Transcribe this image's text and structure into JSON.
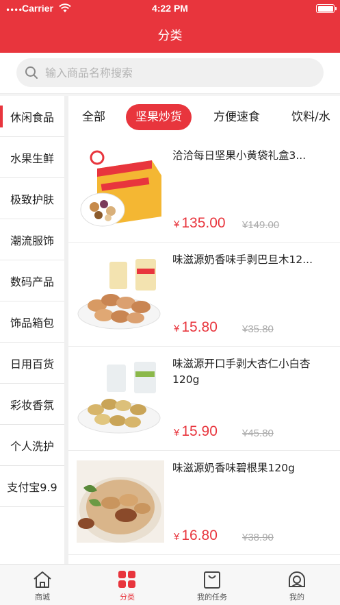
{
  "status": {
    "carrier": "Carrier",
    "time": "4:22 PM"
  },
  "header": {
    "title": "分类"
  },
  "search": {
    "placeholder": "输入商品名称搜索"
  },
  "sidebar": {
    "items": [
      {
        "label": "休闲食品",
        "active": true
      },
      {
        "label": "水果生鲜"
      },
      {
        "label": "极致护肤"
      },
      {
        "label": "潮流服饰"
      },
      {
        "label": "数码产品"
      },
      {
        "label": "饰品箱包"
      },
      {
        "label": "日用百货"
      },
      {
        "label": "彩妆香氛"
      },
      {
        "label": "个人洗护"
      },
      {
        "label": "支付宝9.9"
      }
    ]
  },
  "tabs": [
    {
      "label": "全部"
    },
    {
      "label": "坚果炒货",
      "active": true
    },
    {
      "label": "方便速食"
    },
    {
      "label": "饮料/水"
    }
  ],
  "products": [
    {
      "name": "洽洽每日坚果小黄袋礼盒3...",
      "price": "135.00",
      "old_price": "¥149.00",
      "currency": "¥"
    },
    {
      "name": "味滋源奶香味手剥巴旦木12...",
      "price": "15.80",
      "old_price": "¥35.80",
      "currency": "¥"
    },
    {
      "name": "味滋源开口手剥大杏仁小白杏120g",
      "price": "15.90",
      "old_price": "¥45.80",
      "currency": "¥"
    },
    {
      "name": "味滋源奶香味碧根果120g",
      "price": "16.80",
      "old_price": "¥38.90",
      "currency": "¥"
    }
  ],
  "tabbar": [
    {
      "label": "商城",
      "icon": "home-icon"
    },
    {
      "label": "分类",
      "icon": "grid-icon",
      "active": true
    },
    {
      "label": "我的任务",
      "icon": "bag-icon"
    },
    {
      "label": "我的",
      "icon": "user-icon"
    }
  ],
  "colors": {
    "accent": "#e8353d"
  }
}
